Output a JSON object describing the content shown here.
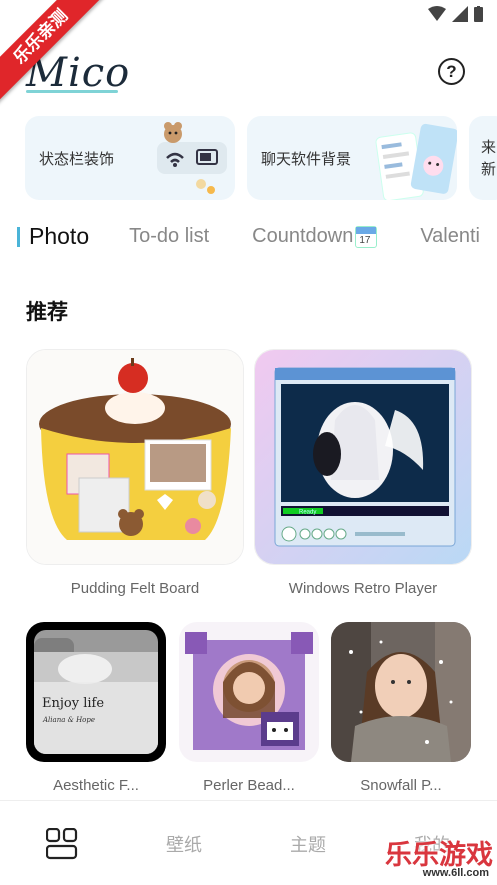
{
  "watermark": {
    "ribbon": "乐乐亲测",
    "corner_title": "乐乐游戏",
    "corner_url": "www.6ll.com"
  },
  "app": {
    "logo": "Mico"
  },
  "shortcuts": [
    {
      "label": "状态栏装饰"
    },
    {
      "label": "聊天软件背景"
    },
    {
      "label": "来新"
    }
  ],
  "tabs": [
    {
      "label": "Photo",
      "active": true
    },
    {
      "label": "To-do list"
    },
    {
      "label": "Countdown"
    },
    {
      "label": "Valenti"
    }
  ],
  "calendar_icon": {
    "day": "17"
  },
  "section": {
    "title": "推荐"
  },
  "featured": [
    {
      "caption": "Pudding Felt Board"
    },
    {
      "caption": "Windows Retro Player"
    }
  ],
  "retro_player": {
    "status": "Ready"
  },
  "more": [
    {
      "caption": "Aesthetic F...",
      "overlay_title": "Enjoy life",
      "overlay_sub": "Aliana & Hope"
    },
    {
      "caption": "Perler Bead..."
    },
    {
      "caption": "Snowfall P..."
    }
  ],
  "nav": [
    {
      "label": "壁纸"
    },
    {
      "label": "主题"
    },
    {
      "label": "我的"
    }
  ]
}
